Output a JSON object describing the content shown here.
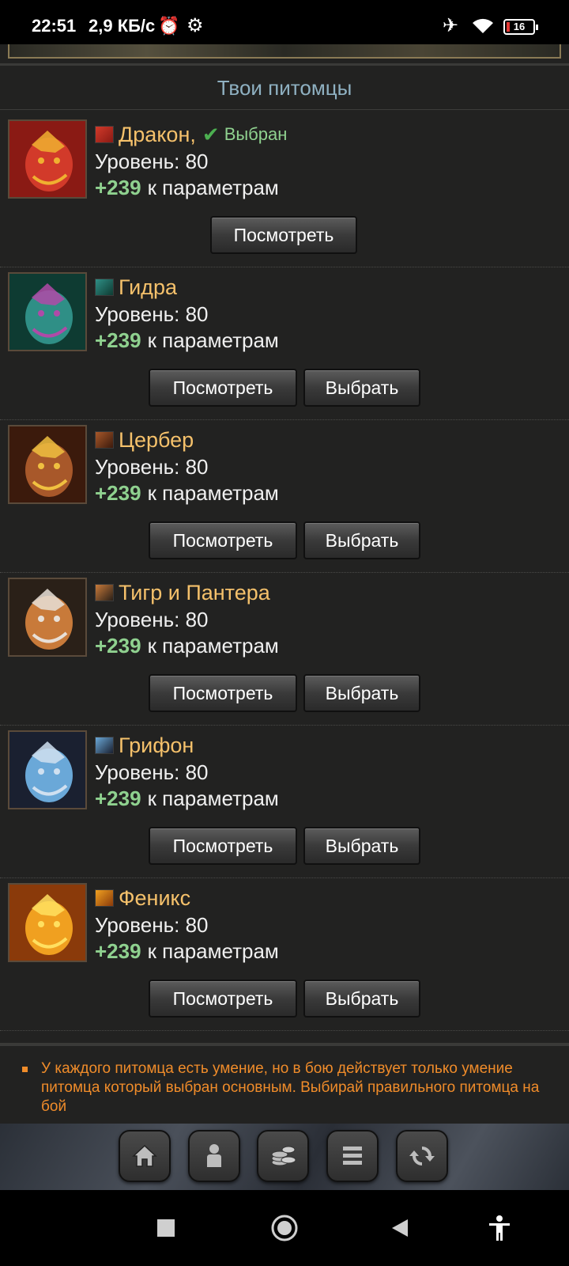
{
  "status_bar": {
    "time": "22:51",
    "speed": "2,9 КБ/с",
    "battery": "16"
  },
  "page": {
    "title": "Твои питомцы",
    "view_label": "Посмотреть",
    "choose_label": "Выбрать",
    "level_label": "Уровень: 80",
    "bonus_value": "+239",
    "bonus_text": "к параметрам",
    "selected_label": "Выбран"
  },
  "pets": [
    {
      "name": "Дракон",
      "selected": true,
      "colors": [
        "#8a1a14",
        "#d23a2a",
        "#f0b030"
      ]
    },
    {
      "name": "Гидра",
      "selected": false,
      "colors": [
        "#0e3b32",
        "#2f8f86",
        "#b04aa8"
      ]
    },
    {
      "name": "Цербер",
      "selected": false,
      "colors": [
        "#3b1a0c",
        "#a8582a",
        "#f0c040"
      ]
    },
    {
      "name": "Тигр и Пантера",
      "selected": false,
      "colors": [
        "#2a2018",
        "#c87a3a",
        "#e8e0d8"
      ]
    },
    {
      "name": "Грифон",
      "selected": false,
      "colors": [
        "#1a2030",
        "#6aa8d8",
        "#d0e0f0"
      ]
    },
    {
      "name": "Феникс",
      "selected": false,
      "colors": [
        "#8a3a0a",
        "#f0a020",
        "#ffe060"
      ]
    }
  ],
  "note": "У каждого питомца есть умение, но в бою действует только умение питомца который выбран основным. Выбирай правильного питомца на бой",
  "bottom_nav": [
    "home-icon",
    "character-icon",
    "coins-icon",
    "menu-icon",
    "refresh-icon"
  ],
  "system_nav": [
    "recents-icon",
    "home-circle-icon",
    "back-icon",
    "accessibility-icon"
  ]
}
